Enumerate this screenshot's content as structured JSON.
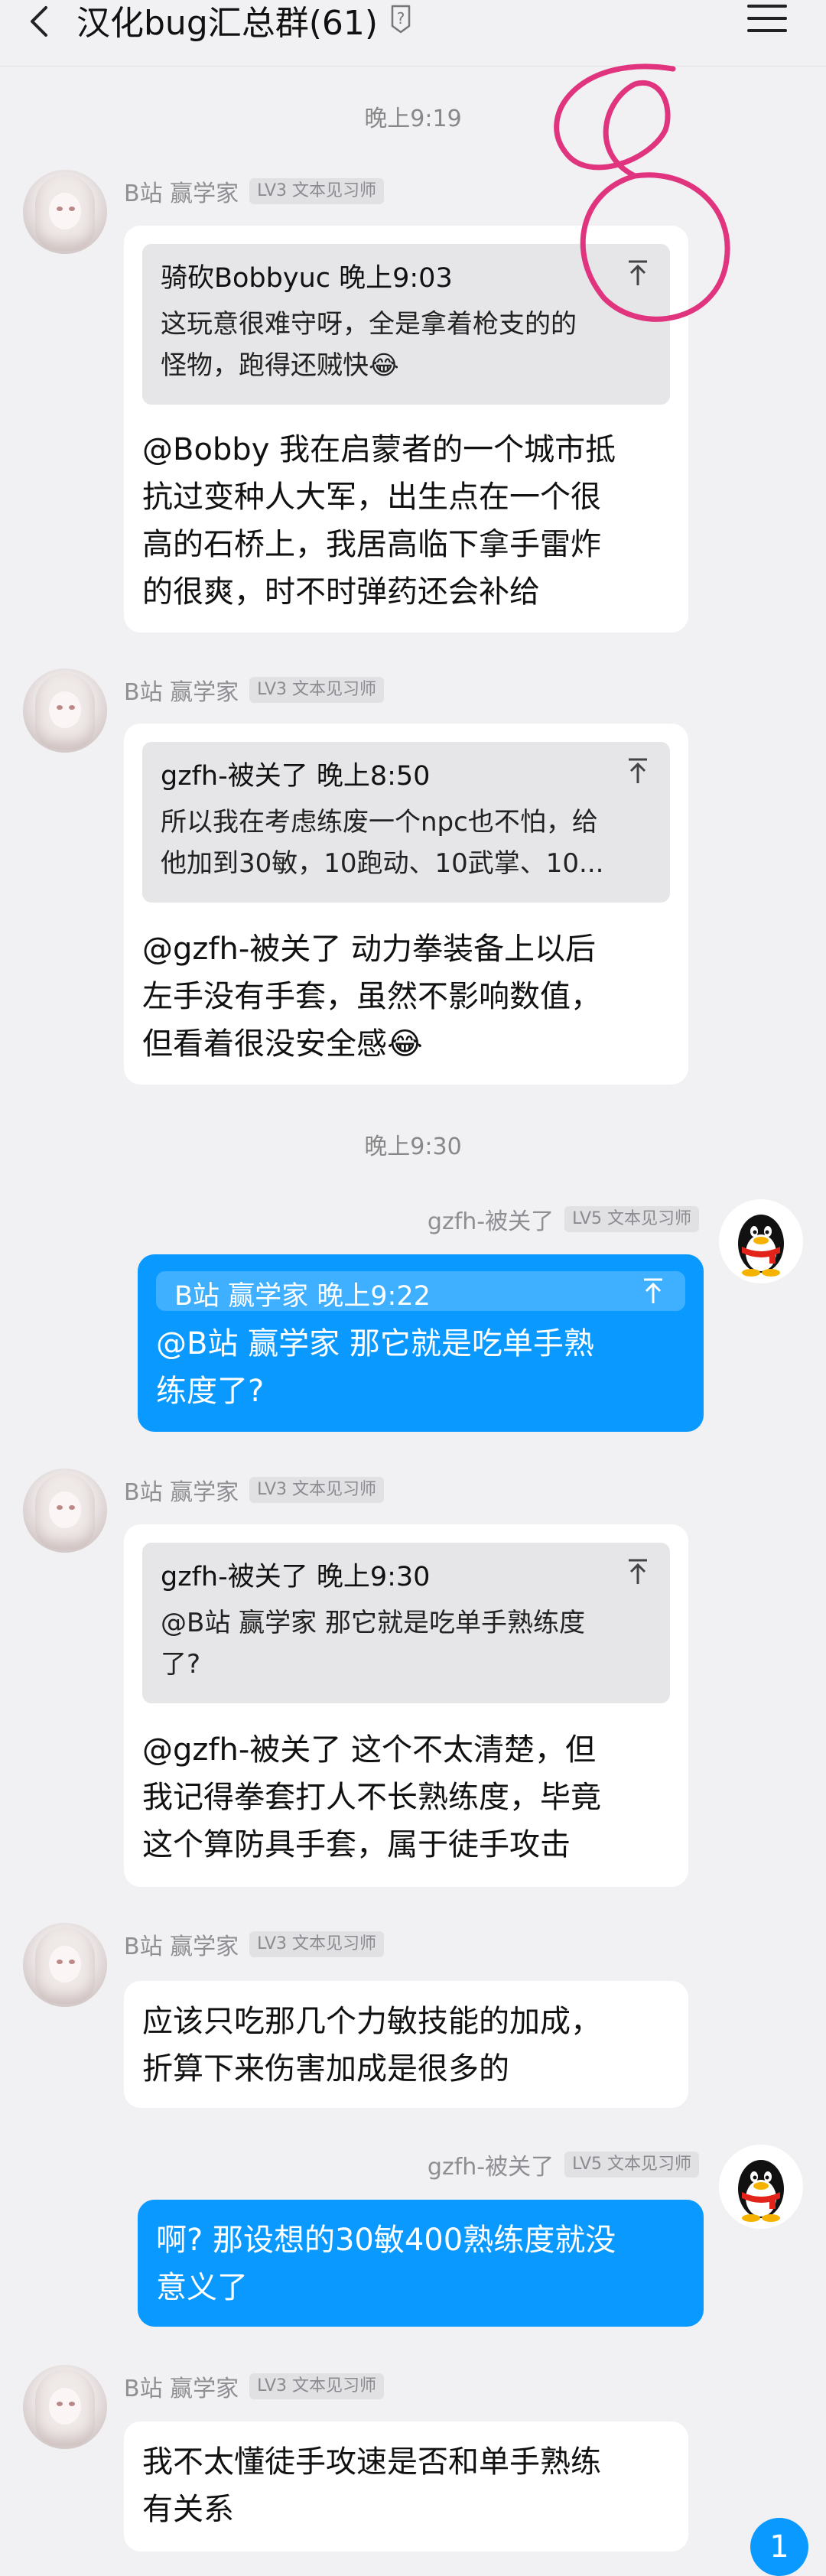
{
  "header": {
    "title": "汉化bug汇总群(61)"
  },
  "timestamps": [
    "晚上9:19",
    "晚上9:30"
  ],
  "users": {
    "b": {
      "name": "B站  赢学家",
      "level": "LV3 文本见习师"
    },
    "g": {
      "name": "gzfh-被关了",
      "level": "LV5 文本见习师"
    }
  },
  "messages": [
    {
      "quote_head": "骑砍Bobbyuc 晚上9:03",
      "quote_lines": [
        "这玩意很难守呀，全是拿着枪支的的",
        "怪物，跑得还贼快😂"
      ],
      "lines": [
        "@Bobby 我在启蒙者的一个城市抵",
        "抗过变种人大军，出生点在一个很",
        "高的石桥上，我居高临下拿手雷炸",
        "的很爽，时不时弹药还会补给"
      ]
    },
    {
      "quote_head": "gzfh-被关了 晚上8:50",
      "quote_lines": [
        "所以我在考虑练废一个npc也不怕，给",
        "他加到30敏，10跑动、10武掌、10..."
      ],
      "lines": [
        "@gzfh-被关了 动力拳装备上以后",
        "左手没有手套，虽然不影响数值，",
        "但看着很没安全感😂"
      ]
    },
    {
      "quote_head": "B站  赢学家 晚上9:22",
      "lines": [
        "@B站  赢学家 那它就是吃单手熟",
        "练度了?"
      ]
    },
    {
      "quote_head": "gzfh-被关了 晚上9:30",
      "quote_lines": [
        "@B站  赢学家 那它就是吃单手熟练度",
        "了?"
      ],
      "lines": [
        "@gzfh-被关了 这个不太清楚，但",
        "我记得拳套打人不长熟练度，毕竟",
        "这个算防具手套，属于徒手攻击"
      ]
    },
    {
      "lines": [
        "应该只吃那几个力敏技能的加成，",
        "折算下来伤害加成是很多的"
      ]
    },
    {
      "lines": [
        "啊? 那设想的30敏400熟练度就没",
        "意义了"
      ]
    },
    {
      "lines": [
        "我不太懂徒手攻速是否和单手熟练",
        "有关系"
      ]
    }
  ],
  "unread_count": "1",
  "colors": {
    "accent": "#0a99ff",
    "annotation": "#e0357e"
  }
}
